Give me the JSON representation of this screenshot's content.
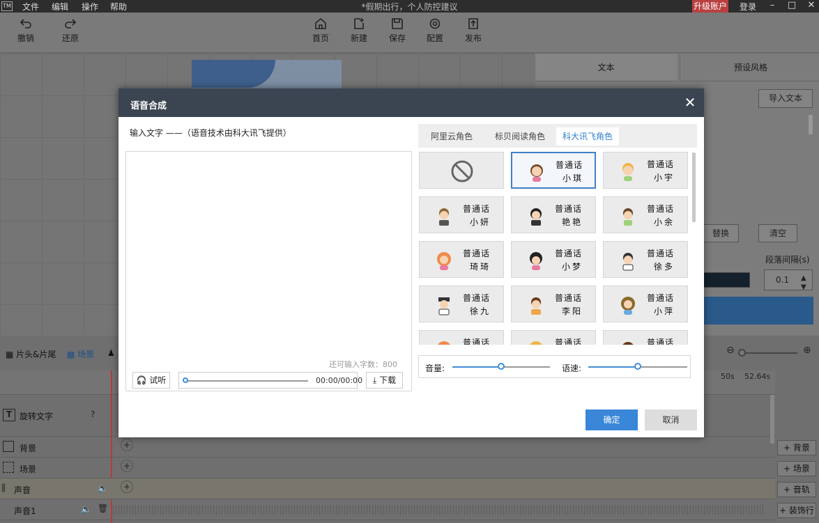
{
  "titlebar": {
    "logo": "TM",
    "menus": [
      "文件",
      "编辑",
      "操作",
      "帮助"
    ],
    "title": "*假期出行，个人防控建议",
    "upgrade": "升级账户",
    "login": "登录"
  },
  "toolbar": {
    "undo": "撤销",
    "redo": "还原",
    "home": "首页",
    "new": "新建",
    "save": "保存",
    "config": "配置",
    "publish": "发布"
  },
  "rightpanel": {
    "tab_text": "文本",
    "tab_style": "预设风格",
    "import": "导入文本",
    "replace": "替换",
    "clear": "清空",
    "para_spacing": "段落间隔(s)",
    "para_value": "0.1"
  },
  "timeline": {
    "tab_head": "片头&片尾",
    "tab_scene": "场景",
    "tick_50": "50s",
    "tick_end": "52.64s",
    "rows": {
      "rotate": "旋转文字",
      "bg": "背景",
      "scene": "场景",
      "sound": "声音",
      "sound1": "声音1"
    },
    "add": {
      "bg": "背景",
      "scene": "场景",
      "track": "音轨",
      "decor": "装饰行"
    }
  },
  "modal": {
    "title": "语音合成",
    "input_label": "输入文字 ——（语音技术由科大讯飞提供）",
    "char_count": "还可输入字数：800",
    "listen": "试听",
    "time": "00:00/00:00",
    "download": "下载",
    "tabs": [
      "阿里云角色",
      "标贝阅读角色",
      "科大讯飞角色"
    ],
    "voice_lang": "普通话",
    "voices": [
      "小琪",
      "小宇",
      "小妍",
      "艳艳",
      "小余",
      "琦琦",
      "小梦",
      "徐多",
      "徐九",
      "李阳",
      "小萍"
    ],
    "volume_label": "音量:",
    "speed_label": "语速:",
    "volume": 0.5,
    "speed": 0.5,
    "ok": "确定",
    "cancel": "取消"
  },
  "colors": {
    "accent": "#3a86d8",
    "header": "#3a4551",
    "upgrade": "#b94040"
  }
}
